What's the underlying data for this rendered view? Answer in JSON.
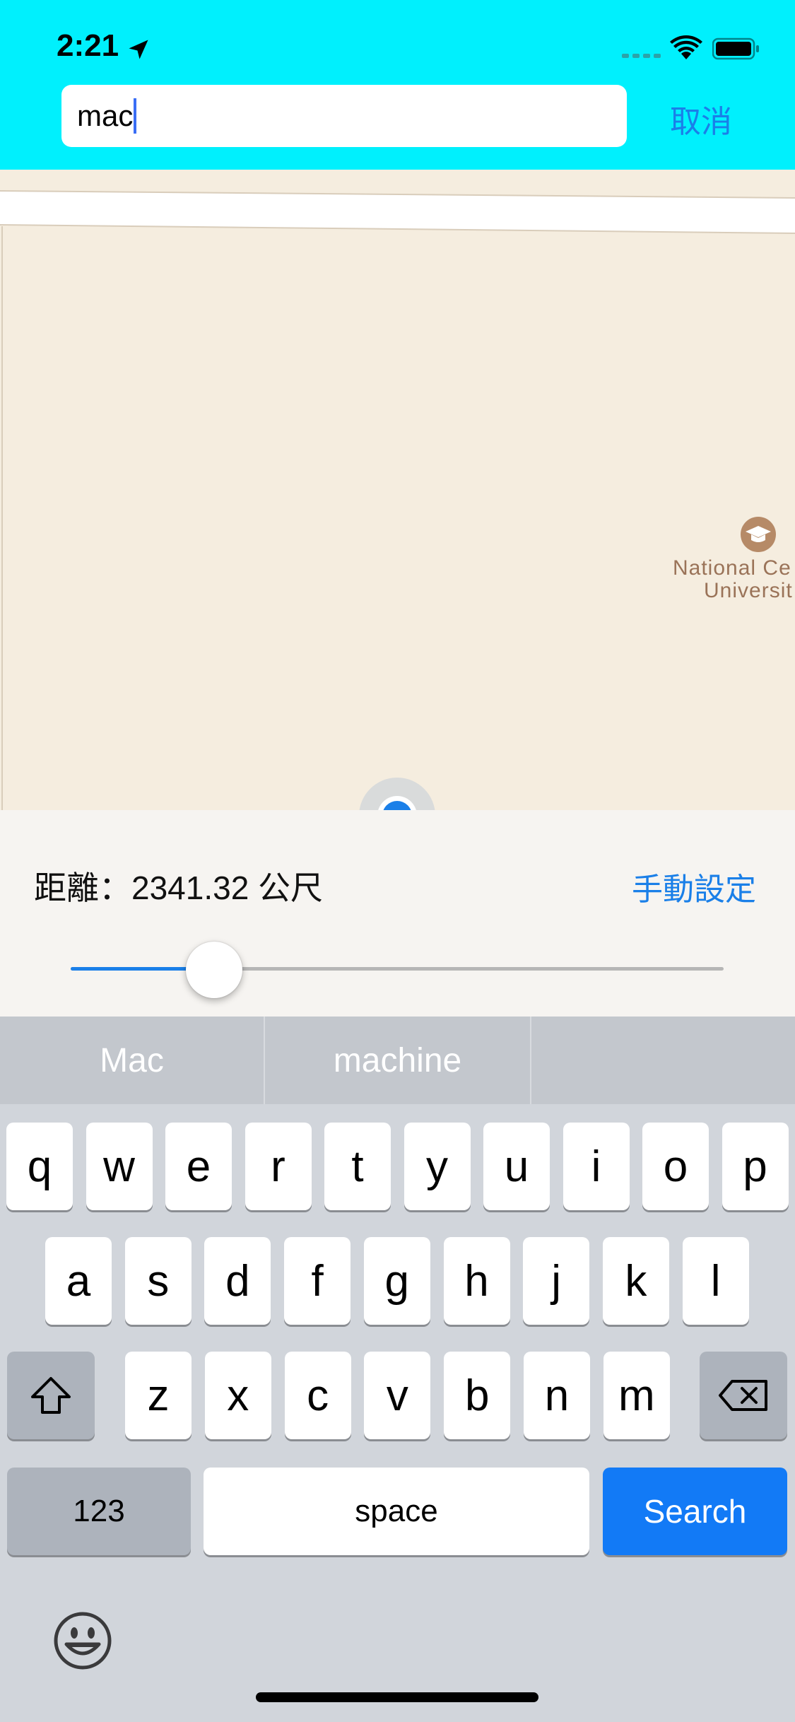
{
  "status_bar": {
    "time": "2:21"
  },
  "search": {
    "value": "mac",
    "cancel_label": "取消"
  },
  "map": {
    "poi_label_line1": "National Ce",
    "poi_label_line2": "Universit"
  },
  "distance_panel": {
    "label": "距離：",
    "value": "2341.32 公尺",
    "manual_label": "手動設定",
    "slider_fraction": 0.22
  },
  "keyboard": {
    "suggestions": [
      "Mac",
      "machine",
      ""
    ],
    "row1": [
      "q",
      "w",
      "e",
      "r",
      "t",
      "y",
      "u",
      "i",
      "o",
      "p"
    ],
    "row2": [
      "a",
      "s",
      "d",
      "f",
      "g",
      "h",
      "j",
      "k",
      "l"
    ],
    "row3": [
      "z",
      "x",
      "c",
      "v",
      "b",
      "n",
      "m"
    ],
    "numbers_label": "123",
    "space_label": "space",
    "search_label": "Search"
  },
  "colors": {
    "accent": "#1a7fe8",
    "topbar": "#00f0fd",
    "search_key": "#127af6",
    "map_land": "#f5eddf"
  }
}
